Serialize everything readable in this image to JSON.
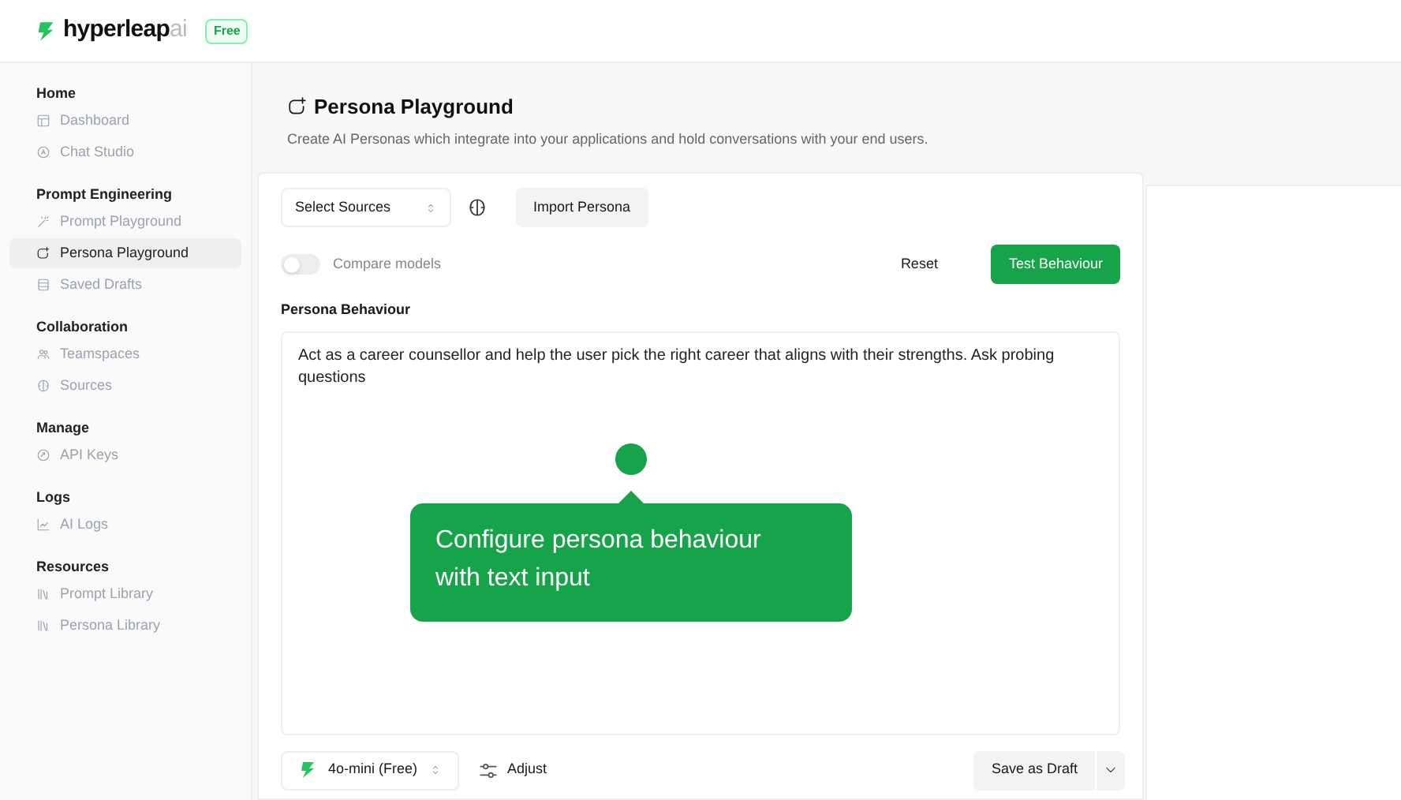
{
  "brand": {
    "name": "hyperleap",
    "suffix": "ai",
    "plan_badge": "Free"
  },
  "sidebar": {
    "sections": [
      {
        "title": "Home",
        "items": [
          {
            "label": "Dashboard",
            "kind": "dashboard",
            "selected": false
          },
          {
            "label": "Chat Studio",
            "kind": "chat",
            "selected": false
          }
        ]
      },
      {
        "title": "Prompt Engineering",
        "items": [
          {
            "label": "Prompt Playground",
            "kind": "wand",
            "selected": false
          },
          {
            "label": "Persona Playground",
            "kind": "persona",
            "selected": true
          },
          {
            "label": "Saved Drafts",
            "kind": "drafts",
            "selected": false
          }
        ]
      },
      {
        "title": "Collaboration",
        "items": [
          {
            "label": "Teamspaces",
            "kind": "team",
            "selected": false
          },
          {
            "label": "Sources",
            "kind": "brain",
            "selected": false
          }
        ]
      },
      {
        "title": "Manage",
        "items": [
          {
            "label": "API Keys",
            "kind": "key",
            "selected": false
          }
        ]
      },
      {
        "title": "Logs",
        "items": [
          {
            "label": "AI Logs",
            "kind": "chart",
            "selected": false
          }
        ]
      },
      {
        "title": "Resources",
        "items": [
          {
            "label": "Prompt Library",
            "kind": "library",
            "selected": false
          },
          {
            "label": "Persona Library",
            "kind": "library",
            "selected": false
          }
        ]
      }
    ]
  },
  "page": {
    "title": "Persona Playground",
    "subtitle": "Create AI Personas which integrate into your applications and hold conversations with your end users."
  },
  "toolbar": {
    "sources_select": "Select Sources",
    "import_button": "Import Persona",
    "compare_models": {
      "label": "Compare models",
      "on": false
    },
    "reset_button": "Reset",
    "test_button": "Test Behaviour"
  },
  "behaviour": {
    "label": "Persona Behaviour",
    "value": "Act as a career counsellor and help the user pick the right career that aligns with their strengths. Ask probing questions"
  },
  "tooltip": {
    "text": "Configure persona behaviour with text input"
  },
  "footer": {
    "model_select": "4o-mini (Free)",
    "adjust_button": "Adjust",
    "save_button": "Save as Draft"
  }
}
